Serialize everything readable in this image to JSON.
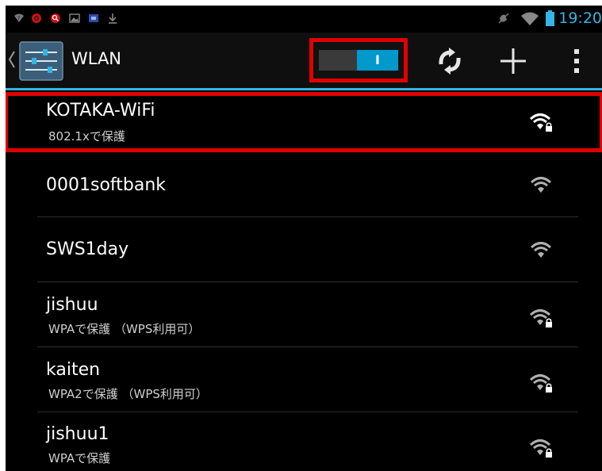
{
  "status_bar": {
    "time": "19:20",
    "left_icons": [
      "wifi-question-icon",
      "notification-red-icon",
      "search-notification-icon",
      "image-icon",
      "keyboard-icon",
      "download-icon"
    ],
    "right_icons": [
      "mute-icon",
      "wifi-signal-icon",
      "battery-icon"
    ]
  },
  "action_bar": {
    "title": "WLAN",
    "switch_label": "I",
    "switch_on": true,
    "accent_color": "#33b5e5"
  },
  "networks": [
    {
      "ssid": "KOTAKA-WiFi",
      "summary": "802.1xで保護",
      "secured": true
    },
    {
      "ssid": "0001softbank",
      "summary": "",
      "secured": false
    },
    {
      "ssid": "SWS1day",
      "summary": "",
      "secured": false
    },
    {
      "ssid": "jishuu",
      "summary": "WPAで保護 （WPS利用可）",
      "secured": true
    },
    {
      "ssid": "kaiten",
      "summary": "WPA2で保護 （WPS利用可）",
      "secured": true
    },
    {
      "ssid": "jishuu1",
      "summary": "WPAで保護",
      "secured": true
    }
  ]
}
